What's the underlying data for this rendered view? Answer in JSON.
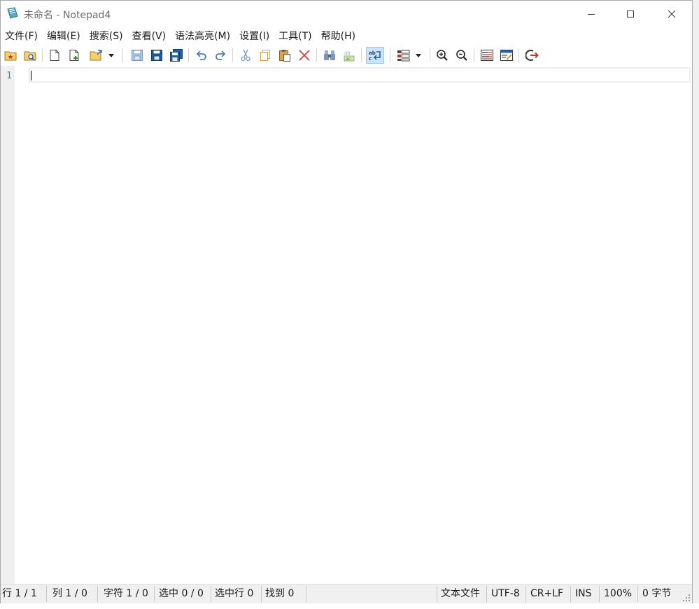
{
  "window": {
    "title": "未命名 - Notepad4"
  },
  "menu": [
    "文件(F)",
    "编辑(E)",
    "搜索(S)",
    "查看(V)",
    "语法高亮(M)",
    "设置(I)",
    "工具(T)",
    "帮助(H)"
  ],
  "toolbar_icons": [
    "favorites-icon",
    "find-file-icon",
    "new-file-icon",
    "new-window-icon",
    "open-folder-icon",
    "dropdown-arrow-icon",
    "save-icon",
    "save-as-icon",
    "save-copy-icon",
    "undo-icon",
    "redo-icon",
    "cut-icon",
    "copy-icon",
    "paste-icon",
    "delete-icon",
    "find-icon",
    "replace-icon",
    "word-wrap-icon",
    "scheme-icon",
    "dropdown-arrow-icon",
    "zoom-in-icon",
    "zoom-out-icon",
    "settings-list-icon",
    "edit-settings-icon",
    "exit-icon"
  ],
  "editor": {
    "line_numbers": [
      "1"
    ],
    "content": ""
  },
  "status": {
    "line": "行 1 / 1",
    "column": "列 1 / 0",
    "character": "字符 1 / 0",
    "selection": "选中 0 / 0",
    "selected_lines": "选中行 0",
    "found": "找到 0",
    "file_type": "文本文件",
    "encoding": "UTF-8",
    "line_ending": "CR+LF",
    "insert_mode": "INS",
    "zoom": "100%",
    "size": "0 字节"
  },
  "colors": {
    "line_number": "#2b91af",
    "gutter": "#f0f0f0",
    "accent": "#cce4f7"
  }
}
